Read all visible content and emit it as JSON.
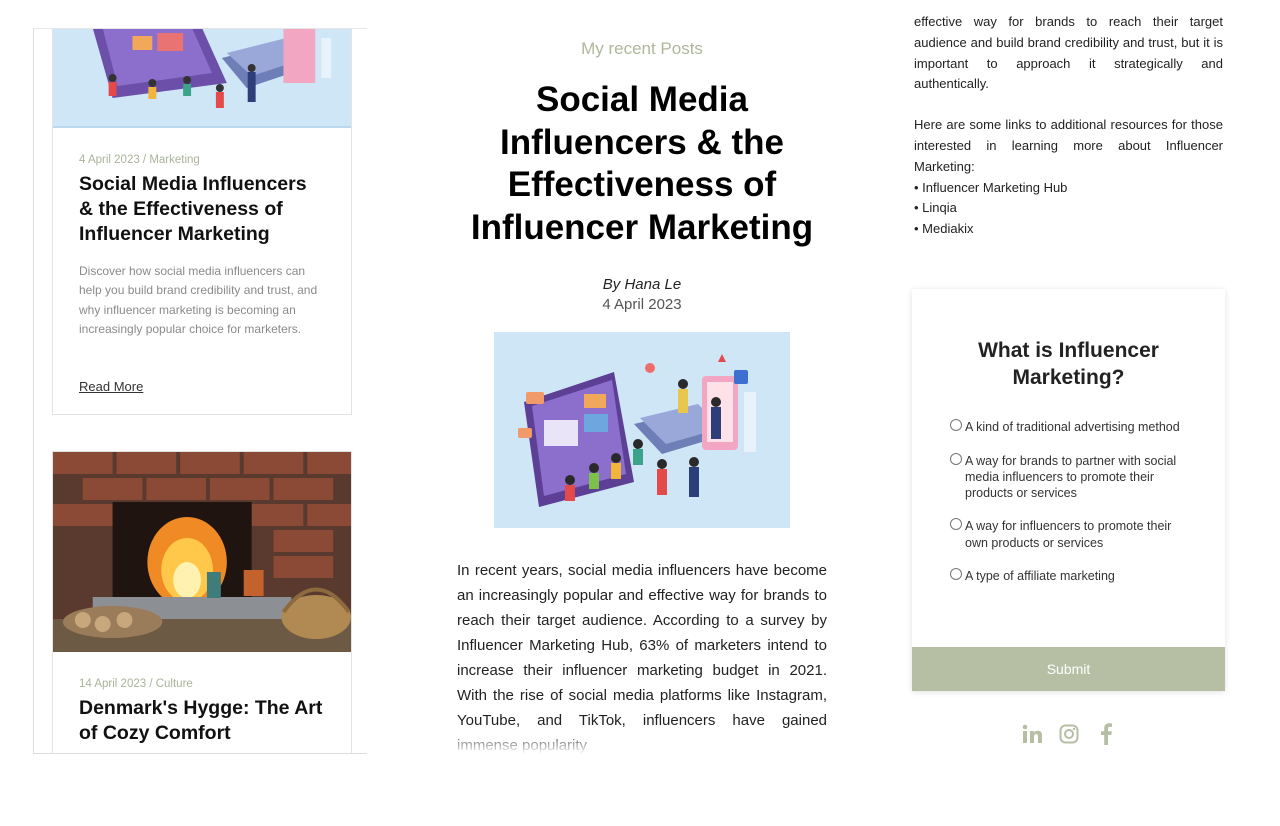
{
  "left": {
    "card1": {
      "meta": "4 April 2023 / Marketing",
      "title": "Social Media Influencers & the Effectiveness of Influencer Marketing",
      "excerpt": "Discover how social media influencers can help you build brand credibility and trust, and why influencer marketing is becoming an increasingly popular choice for marketers.",
      "read_more": "Read More"
    },
    "card2": {
      "meta": "14 April 2023 / Culture",
      "title": "Denmark's Hygge: The Art of Cozy Comfort"
    }
  },
  "post": {
    "section_label": "My recent Posts",
    "title": "Social Media Influencers & the Effectiveness of Influencer Marketing",
    "byline": "By Hana Le",
    "date": "4 April 2023",
    "body": "In recent years, social media influencers have become an increasingly popular and effective way for brands to reach their target audience. According to a survey by Influencer Marketing Hub, 63% of marketers intend to increase their influencer marketing budget in 2021. With the rise of social media platforms like Instagram, YouTube, and TikTok, influencers have gained immense popularity"
  },
  "right": {
    "conclusion": "effective way for brands to reach their target audience and build brand credibility and trust, but it is important to approach it strategically and authentically.",
    "resources_intro": "Here are some links to additional resources for those interested in learning more about Influencer Marketing:",
    "resources": [
      "Influencer Marketing Hub",
      "Linqia",
      "Mediakix"
    ]
  },
  "quiz": {
    "title": "What is Influencer Marketing?",
    "options": [
      "A kind of traditional advertising method",
      "A way for brands to partner with social media influencers to promote their products or services",
      "A way for influencers to promote their own products or services",
      "A type of affiliate marketing"
    ],
    "submit": "Submit"
  },
  "social": {
    "icons": [
      "linkedin-icon",
      "instagram-icon",
      "facebook-icon"
    ],
    "color": "#b6bea4"
  },
  "colors": {
    "accent": "#b6bea4",
    "meta": "#a9b39a"
  }
}
